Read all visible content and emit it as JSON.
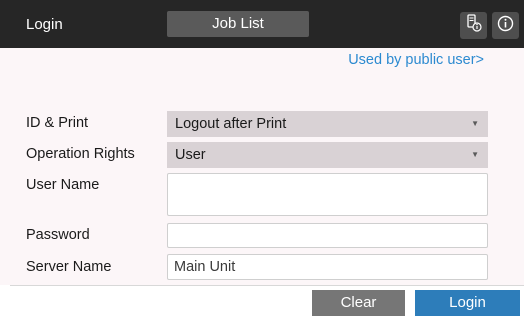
{
  "header": {
    "title": "Login",
    "tab_job_list": "Job List",
    "icons": [
      "device-status-icon",
      "info-icon"
    ]
  },
  "public_user_link": "Used by public user>",
  "form": {
    "id_print": {
      "label": "ID & Print",
      "value": "Logout after Print"
    },
    "operation_rights": {
      "label": "Operation Rights",
      "value": "User"
    },
    "user_name": {
      "label": "User Name",
      "value": ""
    },
    "password": {
      "label": "Password",
      "value": ""
    },
    "server_name": {
      "label": "Server Name",
      "value": "Main Unit"
    }
  },
  "buttons": {
    "clear": "Clear",
    "login": "Login"
  },
  "colors": {
    "topbar": "#262626",
    "link": "#2c8ad0",
    "login_button": "#2d7dba",
    "clear_button": "#767676",
    "select_bg": "#d9d2d5"
  }
}
